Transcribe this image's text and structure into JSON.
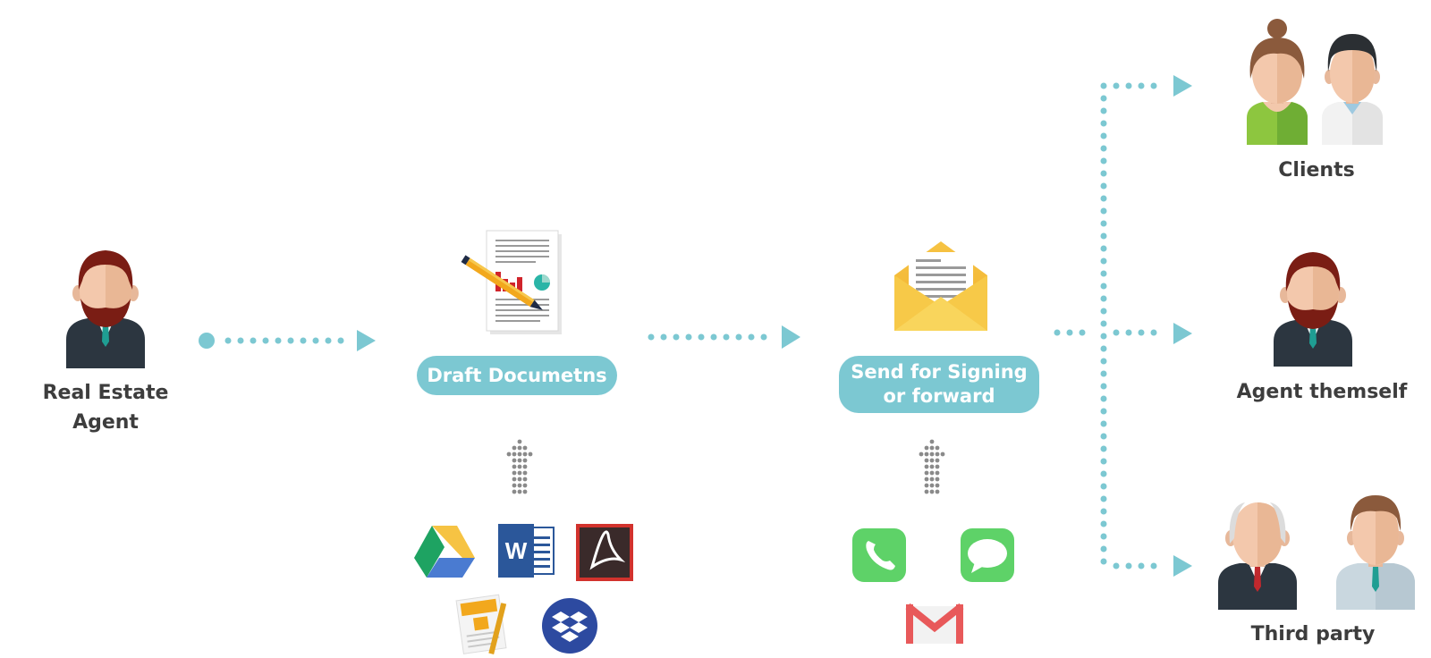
{
  "agent": {
    "label_line1": "Real Estate",
    "label_line2": "Agent"
  },
  "steps": {
    "draft": "Draft Documetns",
    "send_line1": "Send for Signing",
    "send_line2": "or forward"
  },
  "recipients": {
    "clients": "Clients",
    "agent_themself": "Agent themself",
    "third_party": "Third party"
  },
  "draft_tools": [
    "google-drive-icon",
    "word-icon",
    "acrobat-icon",
    "pages-icon",
    "dropbox-icon"
  ],
  "send_tools": [
    "phone-icon",
    "messages-icon",
    "gmail-icon"
  ],
  "colors": {
    "accent": "#7cc8d2",
    "dots": "#7cc8d2",
    "text": "#3d3d3d",
    "grey_arrow": "#8a8a8a"
  }
}
